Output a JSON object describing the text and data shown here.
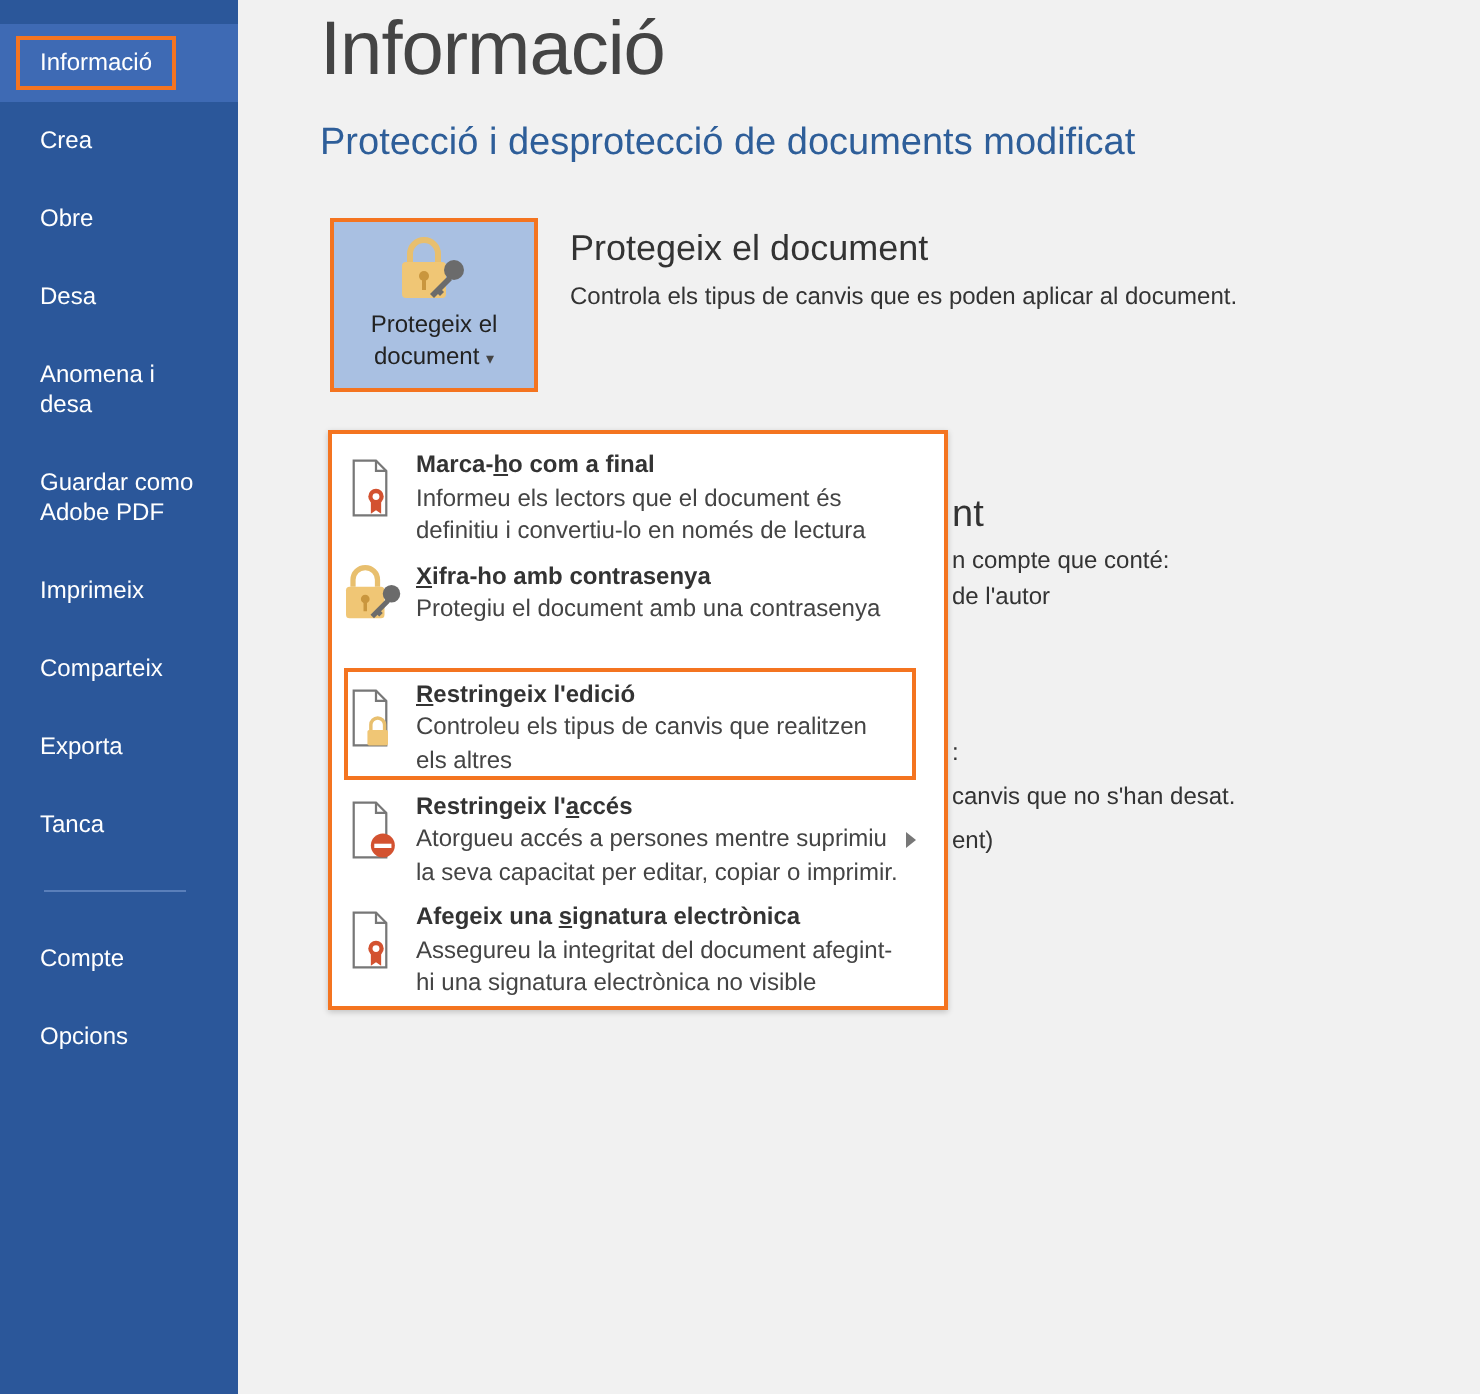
{
  "sidebar": {
    "items": [
      {
        "label": "Informació",
        "selected": true,
        "highlighted": true
      },
      {
        "label": "Crea",
        "selected": false,
        "highlighted": false
      },
      {
        "label": "Obre",
        "selected": false,
        "highlighted": false
      },
      {
        "label": "Desa",
        "selected": false,
        "highlighted": false
      },
      {
        "label": "Anomena i desa",
        "selected": false,
        "highlighted": false
      },
      {
        "label": "Guardar como Adobe PDF",
        "selected": false,
        "highlighted": false
      },
      {
        "label": "Imprimeix",
        "selected": false,
        "highlighted": false
      },
      {
        "label": "Comparteix",
        "selected": false,
        "highlighted": false
      },
      {
        "label": "Exporta",
        "selected": false,
        "highlighted": false
      },
      {
        "label": "Tanca",
        "selected": false,
        "highlighted": false
      }
    ],
    "bottom_items": [
      {
        "label": "Compte",
        "selected": false,
        "highlighted": false
      },
      {
        "label": "Opcions",
        "selected": false,
        "highlighted": false
      }
    ]
  },
  "page": {
    "title": "Informació",
    "subtitle": "Protecció i desprotecció de documents modificat"
  },
  "protect": {
    "button": {
      "label": "Protegeix el document",
      "caret": "▾",
      "highlighted": true
    },
    "heading": "Protegeix el document",
    "description": "Controla els tipus de canvis que es poden aplicar al document."
  },
  "background_texts": [
    {
      "kind": "heading",
      "text": "nt"
    },
    {
      "kind": "line",
      "text": "n compte que conté:"
    },
    {
      "kind": "line",
      "text": "de l'autor"
    },
    {
      "kind": "mark",
      "text": ":"
    },
    {
      "kind": "line",
      "text": "canvis que no s'han desat."
    },
    {
      "kind": "line",
      "text": "ent)"
    }
  ],
  "menu": {
    "highlighted": true,
    "items": [
      {
        "title": {
          "before": "Marca-",
          "key": "h",
          "after": "o com a final"
        },
        "description": "Informeu els lectors que el document és definitiu i convertiu-lo en només de lectura",
        "highlighted": false,
        "submenu": false
      },
      {
        "title": {
          "key": "X",
          "after": "ifra-ho amb contrasenya"
        },
        "description": "Protegiu el document amb una contrasenya",
        "highlighted": false,
        "submenu": false
      },
      {
        "title": {
          "key": "R",
          "after": "estringeix l'edició"
        },
        "description": "Controleu els tipus de canvis que realitzen els altres",
        "highlighted": true,
        "submenu": false
      },
      {
        "title": {
          "before": "Restringeix l'",
          "key": "a",
          "after": "ccés"
        },
        "description": "Atorgueu accés a persones mentre suprimiu la seva capacitat per editar, copiar o imprimir.",
        "highlighted": false,
        "submenu": true
      },
      {
        "title": {
          "before": "Afegeix una ",
          "key": "s",
          "after": "ignatura electrònica"
        },
        "description": "Assegureu la integritat del document afegint-hi una signatura electrònica no visible",
        "highlighted": false,
        "submenu": false
      }
    ]
  }
}
